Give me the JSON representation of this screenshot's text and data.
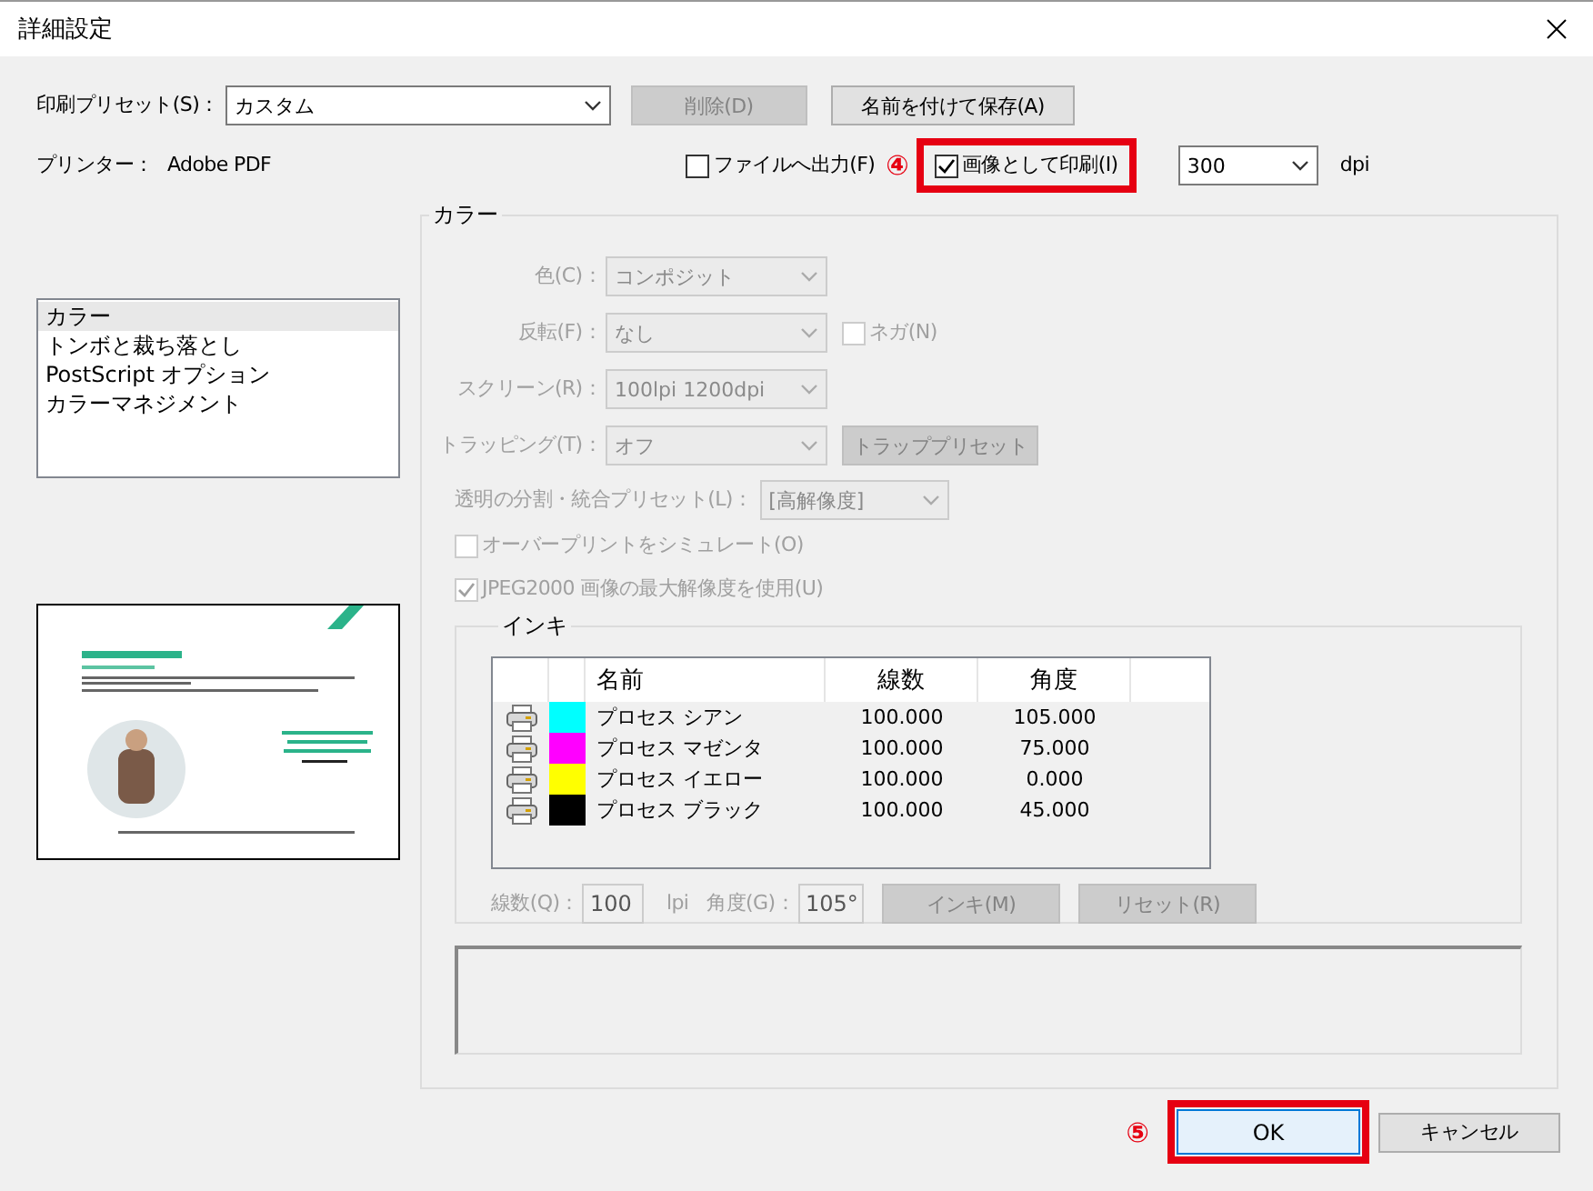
{
  "window": {
    "title": "詳細設定"
  },
  "preset": {
    "label": "印刷プリセット(S)：",
    "value": "カスタム"
  },
  "preset_buttons": [
    {
      "label": "削除(D)",
      "disabled": true
    },
    {
      "label": "名前を付けて保存(A)",
      "disabled": false
    }
  ],
  "printer": {
    "label": "プリンター：",
    "value": "Adobe PDF"
  },
  "output_to_file": {
    "label": "ファイルへ出力(F)",
    "checked": false
  },
  "callout_top": "④",
  "print_as_image": {
    "label": "画像として印刷(I)",
    "checked": true,
    "highlighted": true
  },
  "dpi": {
    "value": "300",
    "unit": "dpi"
  },
  "categories": [
    {
      "label": "カラー",
      "selected": true
    },
    {
      "label": "トンボと裁ち落とし",
      "selected": false
    },
    {
      "label": "PostScript オプション",
      "selected": false
    },
    {
      "label": "カラーマネジメント",
      "selected": false
    }
  ],
  "color_group": {
    "title": "カラー",
    "disabled": true,
    "rows": [
      {
        "kind": "select",
        "label": "色(C)：",
        "value": "コンポジット"
      },
      {
        "kind": "select",
        "label": "反転(F)：",
        "value": "なし",
        "extra": {
          "kind": "checkbox",
          "label": "ネガ(N)",
          "checked": false
        }
      },
      {
        "kind": "select",
        "label": "スクリーン(R)：",
        "value": "100lpi 1200dpi"
      },
      {
        "kind": "select",
        "label": "トラッピング(T)：",
        "value": "オフ",
        "extra": {
          "kind": "button",
          "label": "トラッププリセット"
        }
      },
      {
        "kind": "wide_select",
        "label": "透明の分割・統合プリセット(L)：",
        "value": "[高解像度]"
      },
      {
        "kind": "checkbox",
        "label": "オーバープリントをシミュレート(O)",
        "checked": false
      },
      {
        "kind": "checkbox",
        "label": "JPEG2000 画像の最大解像度を使用(U)",
        "checked": true
      }
    ]
  },
  "inks": {
    "title": "インキ",
    "columns": [
      "名前",
      "線数",
      "角度"
    ],
    "rows": [
      {
        "name": "プロセス シアン",
        "color": "#00ffff",
        "frequency": "100.000",
        "angle": "105.000"
      },
      {
        "name": "プロセス マゼンタ",
        "color": "#ff00ff",
        "frequency": "100.000",
        "angle": "75.000"
      },
      {
        "name": "プロセス イエロー",
        "color": "#ffff00",
        "frequency": "100.000",
        "angle": "0.000"
      },
      {
        "name": "プロセス ブラック",
        "color": "#000000",
        "frequency": "100.000",
        "angle": "45.000"
      }
    ],
    "frequency": {
      "label": "線数(Q)：",
      "value": "100",
      "unit": "lpi"
    },
    "angle": {
      "label": "角度(G)：",
      "value": "105°"
    },
    "buttons": [
      {
        "label": "インキ(M)",
        "disabled": true
      },
      {
        "label": "リセット(R)",
        "disabled": true
      }
    ]
  },
  "callout_bottom": "⑤",
  "ok": {
    "label": "OK",
    "highlighted": true
  },
  "cancel": {
    "label": "キャンセル"
  }
}
